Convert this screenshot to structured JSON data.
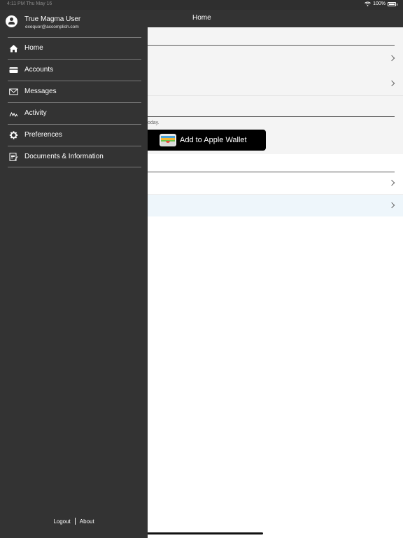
{
  "status_bar": {
    "time": "4:11 PM   Thu May 16",
    "battery": "100%"
  },
  "header": {
    "title": "Home"
  },
  "content": {
    "today_text": "oday.",
    "wallet_button": "Add to Apple Wallet"
  },
  "drawer": {
    "user_name": "True Magma User",
    "user_email": "exequor@accomplish.com",
    "items": [
      {
        "label": "Home",
        "icon": "home-icon"
      },
      {
        "label": "Accounts",
        "icon": "card-icon"
      },
      {
        "label": "Messages",
        "icon": "envelope-icon"
      },
      {
        "label": "Activity",
        "icon": "activity-icon"
      },
      {
        "label": "Preferences",
        "icon": "gear-icon"
      },
      {
        "label": "Documents & Information",
        "icon": "document-icon"
      }
    ],
    "footer": {
      "logout": "Logout",
      "about": "About"
    }
  },
  "colors": {
    "drawer_bg": "#333333",
    "nav_bg": "#333333",
    "highlight_row": "#eef6fb"
  }
}
